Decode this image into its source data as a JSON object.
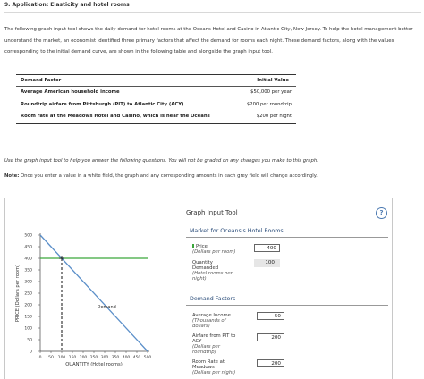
{
  "question": {
    "title": "9. Application: Elasticity and hotel rooms",
    "intro": "The following graph input tool shows the daily demand for hotel rooms at the Oceans Hotel and Casino in Atlantic City, New Jersey. To help the hotel management better understand the market, an economist identified three primary factors that affect the demand for rooms each night. These demand factors, along with the values corresponding to the initial demand curve, are shown in the following table and alongside the graph input tool."
  },
  "factor_table": {
    "header_factor": "Demand Factor",
    "header_value": "Initial Value",
    "rows": [
      {
        "factor": "Average American household income",
        "value": "$50,000 per year"
      },
      {
        "factor": "Roundtrip airfare from Pittsburgh (PIT) to Atlantic City (ACY)",
        "value": "$200 per roundtrip"
      },
      {
        "factor": "Room rate at the Meadows Hotel and Casino, which is near the Oceans",
        "value": "$200 per night"
      }
    ]
  },
  "instructions": {
    "use_tool": "Use the graph input tool to help you answer the following questions. You will not be graded on any changes you make to this graph.",
    "note_label": "Note:",
    "note_text": " Once you enter a value in a white field, the graph and any corresponding amounts in each grey field will change accordingly."
  },
  "tool": {
    "title": "Graph Input Tool",
    "help": "?",
    "market_title": "Market for Oceans's Hotel Rooms",
    "price_label": "Price",
    "price_sub": "(Dollars per room)",
    "price_value": "400",
    "qty_label_1": "Quantity",
    "qty_label_2": "Demanded",
    "qty_sub_1": "(Hotel rooms per",
    "qty_sub_2": "night)",
    "qty_value": "100",
    "factors_title": "Demand Factors",
    "income_label": "Average Income",
    "income_sub_1": "(Thousands of",
    "income_sub_2": "dollars)",
    "income_value": "50",
    "airfare_label_1": "Airfare from PIT to",
    "airfare_label_2": "ACY",
    "airfare_sub_1": "(Dollars per",
    "airfare_sub_2": "roundtrip)",
    "airfare_value": "200",
    "roomrate_label_1": "Room Rate at",
    "roomrate_label_2": "Meadows",
    "roomrate_sub": "(Dollars per night)",
    "roomrate_value": "200"
  },
  "chart_data": {
    "type": "line",
    "xlabel": "QUANTITY (Hotel rooms)",
    "ylabel": "PRICE (Dollars per room)",
    "xlim": [
      0,
      500
    ],
    "ylim": [
      0,
      500
    ],
    "x_ticks": [
      0,
      50,
      100,
      150,
      200,
      250,
      300,
      350,
      400,
      450,
      500
    ],
    "y_ticks": [
      0,
      50,
      100,
      150,
      200,
      250,
      300,
      350,
      400,
      450,
      500
    ],
    "series": [
      {
        "name": "Demand",
        "points": [
          [
            0,
            500
          ],
          [
            500,
            0
          ]
        ]
      }
    ],
    "price_line": 400,
    "selected_point": [
      100,
      400
    ],
    "colors": {
      "demand": "#5b8fc9",
      "price_line": "#3aa63a",
      "point": "#111111"
    }
  }
}
